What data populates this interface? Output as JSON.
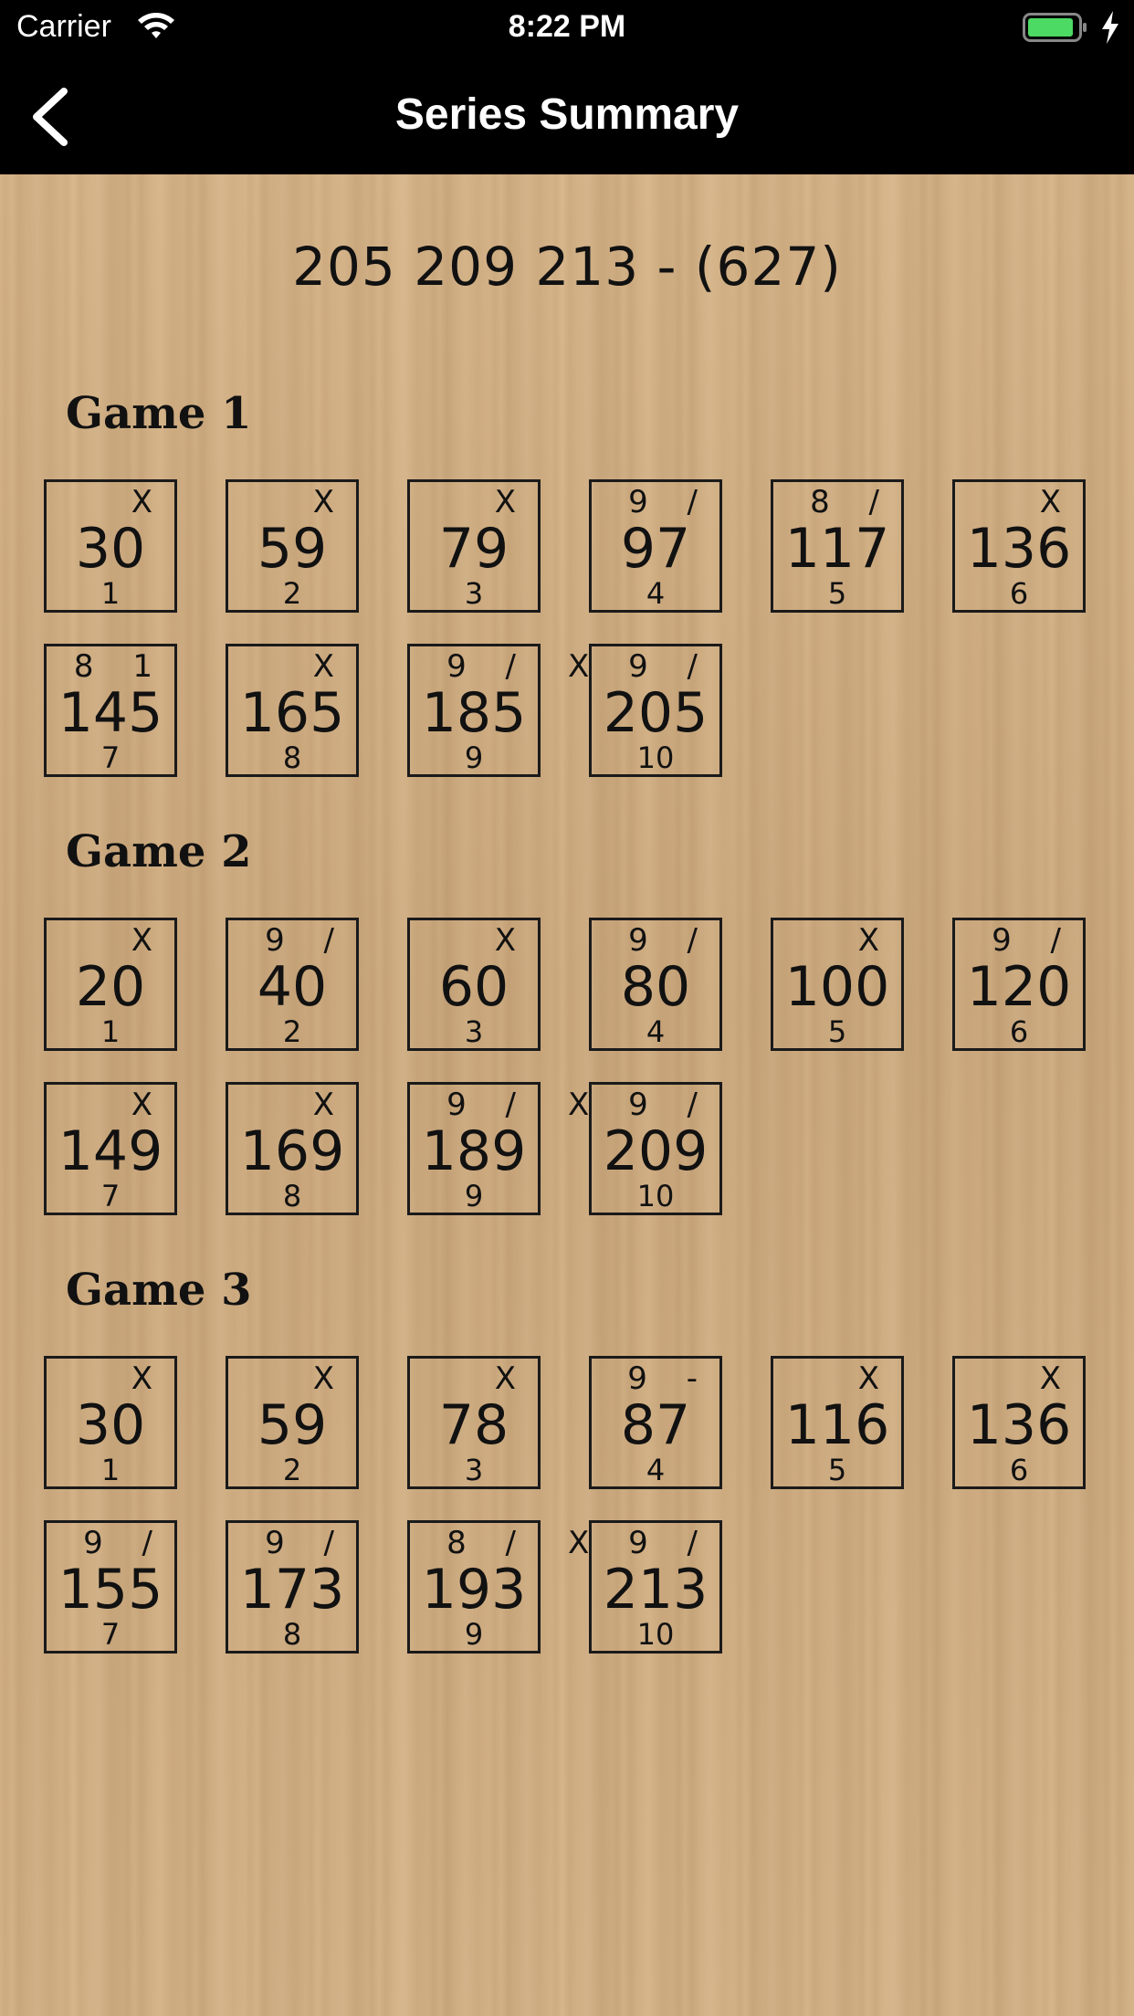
{
  "status_bar": {
    "carrier": "Carrier",
    "time": "8:22 PM"
  },
  "nav": {
    "title": "Series Summary",
    "back_icon": "chevron-left-icon"
  },
  "series_summary": "205 209 213 - (627)",
  "colors": {
    "nav_bg": "#000000",
    "battery": "#4cd964",
    "background": "#cfae84",
    "ink": "#111111"
  },
  "games": [
    {
      "title": "Game 1",
      "frames": [
        {
          "marks": "X",
          "score": "30",
          "number": "1"
        },
        {
          "marks": "X",
          "score": "59",
          "number": "2"
        },
        {
          "marks": "X",
          "score": "79",
          "number": "3"
        },
        {
          "marks": "9 /",
          "score": "97",
          "number": "4"
        },
        {
          "marks": "8 /",
          "score": "117",
          "number": "5"
        },
        {
          "marks": "X",
          "score": "136",
          "number": "6"
        },
        {
          "marks": "8 1",
          "score": "145",
          "number": "7"
        },
        {
          "marks": "X",
          "score": "165",
          "number": "8"
        },
        {
          "marks": "9 /",
          "score": "185",
          "number": "9"
        },
        {
          "marks": "X 9 /",
          "score": "205",
          "number": "10"
        }
      ]
    },
    {
      "title": "Game 2",
      "frames": [
        {
          "marks": "X",
          "score": "20",
          "number": "1"
        },
        {
          "marks": "9 /",
          "score": "40",
          "number": "2"
        },
        {
          "marks": "X",
          "score": "60",
          "number": "3"
        },
        {
          "marks": "9 /",
          "score": "80",
          "number": "4"
        },
        {
          "marks": "X",
          "score": "100",
          "number": "5"
        },
        {
          "marks": "9 /",
          "score": "120",
          "number": "6"
        },
        {
          "marks": "X",
          "score": "149",
          "number": "7"
        },
        {
          "marks": "X",
          "score": "169",
          "number": "8"
        },
        {
          "marks": "9 /",
          "score": "189",
          "number": "9"
        },
        {
          "marks": "X 9 /",
          "score": "209",
          "number": "10"
        }
      ]
    },
    {
      "title": "Game 3",
      "frames": [
        {
          "marks": "X",
          "score": "30",
          "number": "1"
        },
        {
          "marks": "X",
          "score": "59",
          "number": "2"
        },
        {
          "marks": "X",
          "score": "78",
          "number": "3"
        },
        {
          "marks": "9 -",
          "score": "87",
          "number": "4"
        },
        {
          "marks": "X",
          "score": "116",
          "number": "5"
        },
        {
          "marks": "X",
          "score": "136",
          "number": "6"
        },
        {
          "marks": "9 /",
          "score": "155",
          "number": "7"
        },
        {
          "marks": "9 /",
          "score": "173",
          "number": "8"
        },
        {
          "marks": "8 /",
          "score": "193",
          "number": "9"
        },
        {
          "marks": "X 9 /",
          "score": "213",
          "number": "10"
        }
      ]
    }
  ]
}
